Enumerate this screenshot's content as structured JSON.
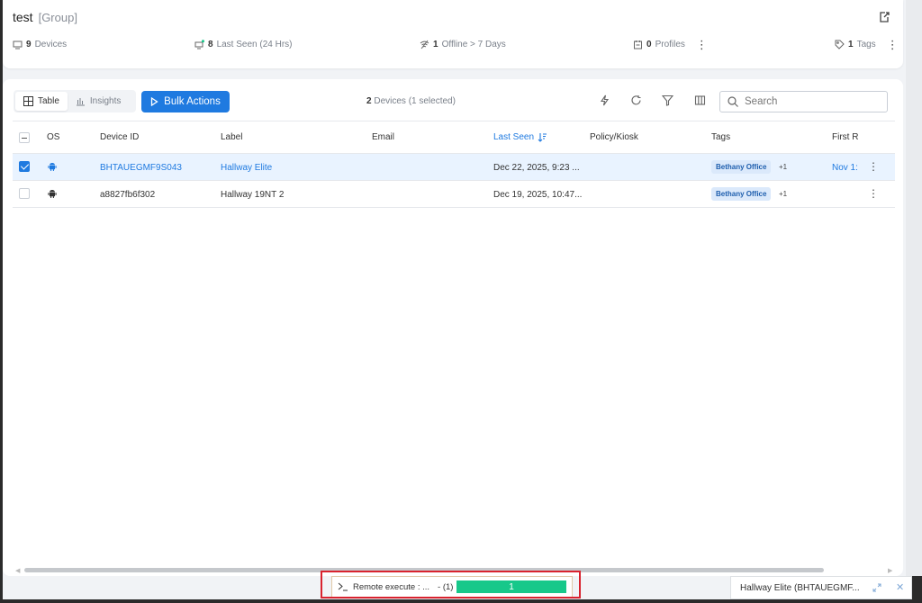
{
  "header": {
    "title": "test",
    "title_suffix": "[Group]",
    "stats": {
      "devices_count": "9",
      "devices_label": "Devices",
      "last_seen_count": "8",
      "last_seen_label": "Last Seen (24 Hrs)",
      "offline_count": "1",
      "offline_label": "Offline > 7 Days",
      "profiles_count": "0",
      "profiles_label": "Profiles",
      "tags_count": "1",
      "tags_label": "Tags"
    }
  },
  "toolbar": {
    "view_table": "Table",
    "view_insights": "Insights",
    "bulk_actions": "Bulk Actions",
    "devices_count": "2",
    "devices_suffix": "Devices (1 selected)",
    "search_placeholder": "Search"
  },
  "table": {
    "columns": [
      "OS",
      "Device ID",
      "Label",
      "Email",
      "Last Seen",
      "Policy/Kiosk",
      "Tags",
      "First R"
    ],
    "rows": [
      {
        "selected": true,
        "os": "android",
        "device_id": "BHTAUEGMF9S043",
        "label": "Hallway Elite",
        "email": "",
        "last_seen": "Dec 22, 2025, 9:23 ...",
        "policy": "",
        "tag": "Bethany Office",
        "tag_more": "+1",
        "first_r": "Nov 1:"
      },
      {
        "selected": false,
        "os": "android",
        "device_id": "a8827fb6f302",
        "label": "Hallway 19NT 2",
        "email": "",
        "last_seen": "Dec 19, 2025, 10:47...",
        "policy": "",
        "tag": "Bethany Office",
        "tag_more": "+1",
        "first_r": ""
      }
    ]
  },
  "task_bar": {
    "label": "Remote execute : ...",
    "count": "- (1)",
    "progress_value": "1",
    "progress_fraction": 1.0
  },
  "mini_panel": {
    "title": "Hallway Elite (BHTAUEGMF..."
  },
  "colors": {
    "accent": "#1f7ae0",
    "progress": "#17c88a",
    "highlight": "#d9232f",
    "tag_bg": "#dbe9fb"
  }
}
